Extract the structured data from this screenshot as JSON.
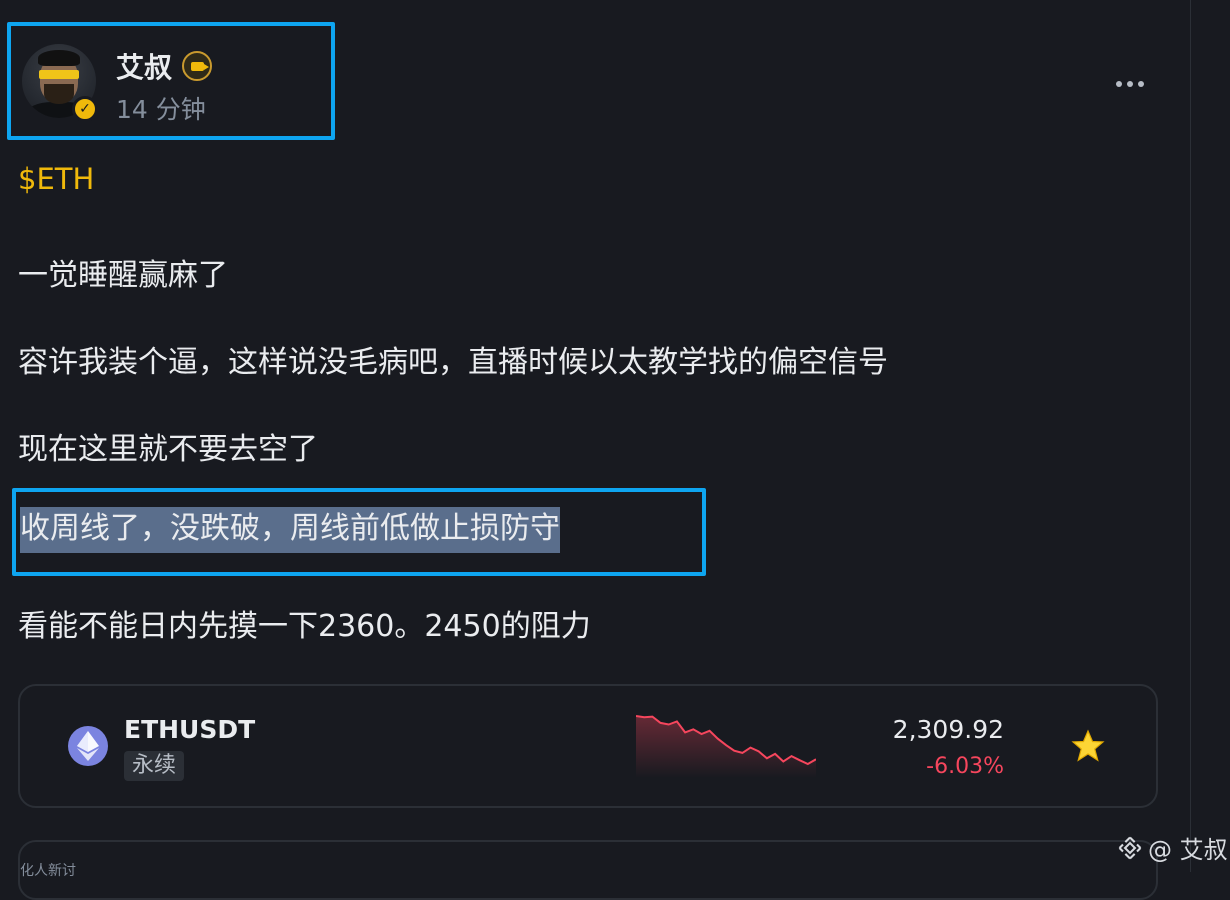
{
  "author": {
    "name": "艾叔",
    "time_ago": "14 分钟"
  },
  "post": {
    "cashtag": "$ETH",
    "paragraphs": [
      "一觉睡醒赢麻了",
      "容许我装个逼，这样说没毛病吧，直播时候以太教学找的偏空信号",
      "现在这里就不要去空了",
      "收周线了，没跌破，周线前低做止损防守",
      "看能不能日内先摸一下2360。2450的阻力"
    ]
  },
  "ticker": {
    "symbol": "ETHUSDT",
    "contract_type": "永续",
    "price": "2,309.92",
    "change": "-6.03%",
    "change_color": "#f6465d",
    "sparkline": [
      2452,
      2448,
      2450,
      2430,
      2425,
      2435,
      2400,
      2410,
      2395,
      2405,
      2380,
      2360,
      2342,
      2335,
      2352,
      2340,
      2318,
      2332,
      2308,
      2325,
      2312,
      2300,
      2315
    ]
  },
  "next_card": {
    "text": "化人新讨"
  },
  "watermark": {
    "text": "@ 艾叔"
  },
  "icons": {
    "verified": "verified-badge-icon",
    "creator": "creator-badge-icon",
    "more": "more-icon",
    "star": "star-icon",
    "eth": "eth-icon",
    "logo": "binance-logo-icon"
  },
  "colors": {
    "background": "#181a20",
    "accent": "#f0b90b",
    "highlight_border": "#0ea5f0",
    "selection": "#5a6e8c",
    "negative": "#f6465d"
  }
}
